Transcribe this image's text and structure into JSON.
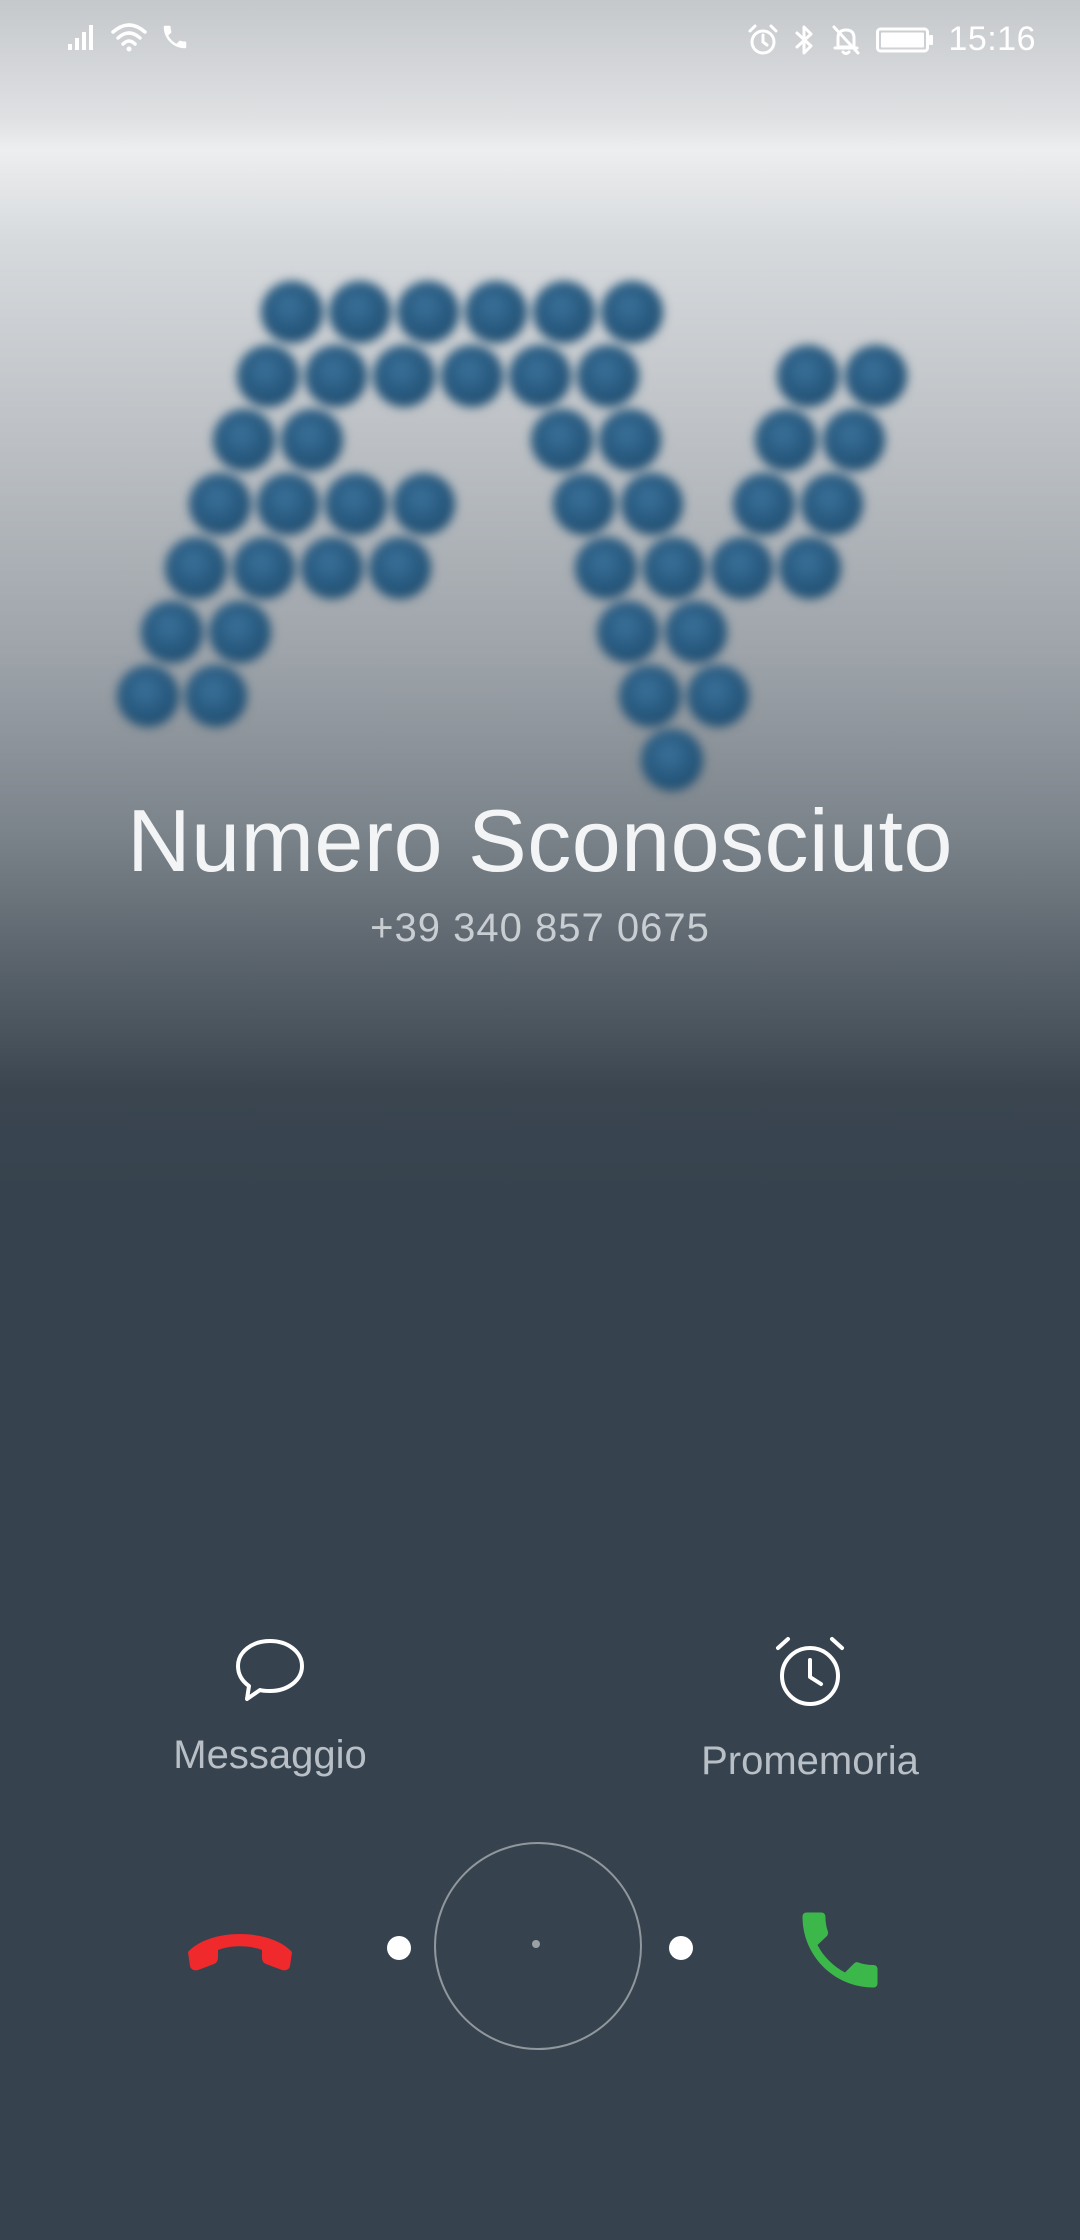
{
  "status_bar": {
    "time": "15:16",
    "left_icons": [
      "signal-icon",
      "wifi-icon",
      "call-active-icon"
    ],
    "right_icons": [
      "alarm-icon",
      "bluetooth-icon",
      "notifications-off-icon",
      "battery-icon"
    ]
  },
  "caller": {
    "avatar": "fv-dotted-logo",
    "name": "Numero Sconosciuto",
    "number": "+39 340 857 0675"
  },
  "quick_actions": {
    "message_label": "Messaggio",
    "message_icon": "chat-bubble-icon",
    "reminder_label": "Promemoria",
    "reminder_icon": "alarm-clock-icon"
  },
  "call_controls": {
    "decline_icon": "phone-hangup-icon",
    "answer_icon": "phone-answer-icon",
    "decline_color": "#f0292d",
    "answer_color": "#3cb84a"
  },
  "colors": {
    "background_bottom": "#36434e",
    "logo_dots": "#2b5f86"
  }
}
